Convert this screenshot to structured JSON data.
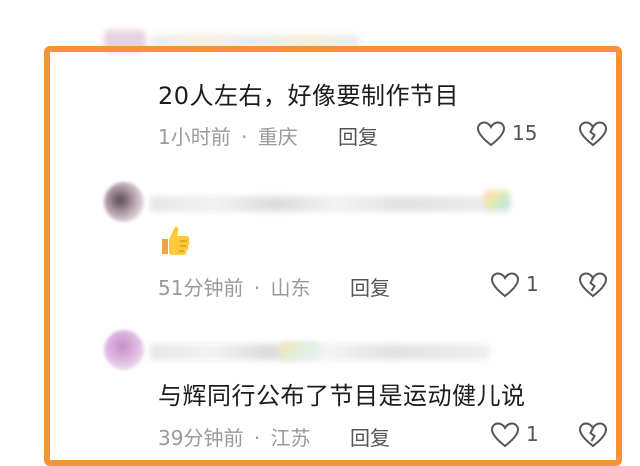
{
  "colors": {
    "frame": "#f5923a",
    "meta_text": "#9a9a9a",
    "action_text": "#555555",
    "body_text": "#1c1c1c"
  },
  "comments": [
    {
      "text": "20人左右，好像要制作节目",
      "time": "1小时前",
      "separator": "·",
      "location": "重庆",
      "reply_label": "回复",
      "like_count": "15",
      "like_icon": "heart-outline-icon",
      "dislike_icon": "broken-heart-icon"
    },
    {
      "emoji": "thumbs-up-emoji",
      "time": "51分钟前",
      "separator": "·",
      "location": "山东",
      "reply_label": "回复",
      "like_count": "1",
      "like_icon": "heart-outline-icon",
      "dislike_icon": "broken-heart-icon"
    },
    {
      "text": "与辉同行公布了节目是运动健儿说",
      "time": "39分钟前",
      "separator": "·",
      "location": "江苏",
      "reply_label": "回复",
      "like_count": "1",
      "like_icon": "heart-outline-icon",
      "dislike_icon": "broken-heart-icon"
    }
  ]
}
